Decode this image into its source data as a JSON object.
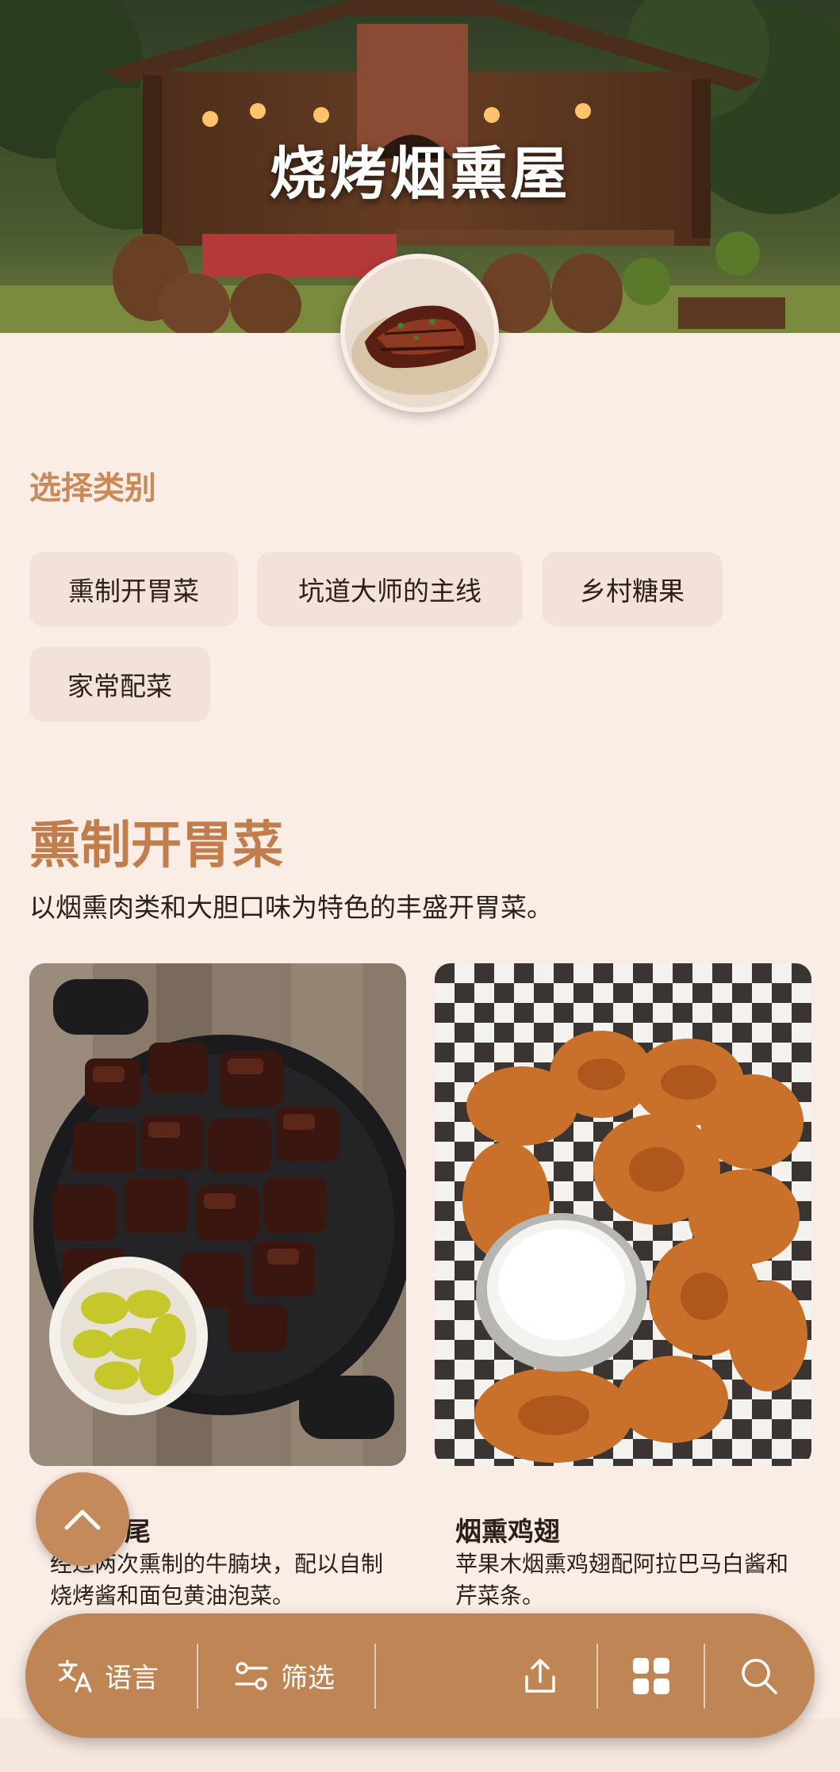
{
  "app": {
    "title": "烧烤烟熏屋"
  },
  "categories": {
    "heading": "选择类别",
    "items": [
      {
        "label": "熏制开胃菜"
      },
      {
        "label": "坑道大师的主线"
      },
      {
        "label": "乡村糖果"
      },
      {
        "label": "家常配菜"
      }
    ]
  },
  "section": {
    "title": "熏制开胃菜",
    "description": "以烟熏肉类和大胆口味为特色的丰盛开胃菜。"
  },
  "dishes": [
    {
      "name": "尾",
      "description": "经过两次熏制的牛腩块，配以自制烧烤酱和面包黄油泡菜。"
    },
    {
      "name": "烟熏鸡翅",
      "description": "苹果木烟熏鸡翅配阿拉巴马白酱和芹菜条。"
    }
  ],
  "bottom_bar": {
    "language_label": "语言",
    "filter_label": "筛选",
    "icons": [
      "translate-icon",
      "filter-icon",
      "share-icon",
      "grid-icon",
      "search-icon"
    ]
  },
  "colors": {
    "background": "#f9ede6",
    "accent": "#c17d4b",
    "chip": "#f2e2d8",
    "bar": "#c08555"
  }
}
